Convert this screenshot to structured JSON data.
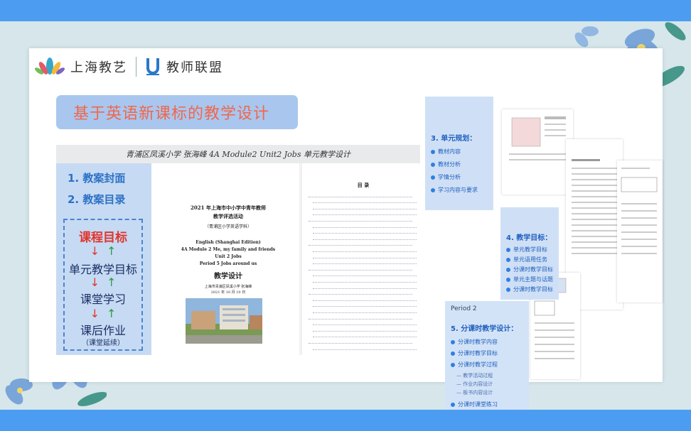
{
  "header": {
    "brand1": "上海教艺",
    "brand2": "教师联盟"
  },
  "slide": {
    "title": "基于英语新课标的教学设计",
    "strip": "青浦区凤溪小学  张海峰    4A Module2 Unit2  Jobs  单元教学设计"
  },
  "left_panel": {
    "item1": "1. 教案封面",
    "item2": "2. 教案目录",
    "flow": [
      "课程目标",
      "单元教学目标",
      "课堂学习",
      "课后作业"
    ],
    "flow_note": "（课堂延续）"
  },
  "cover": {
    "line1": "2021 年上海市中小学中青年教师",
    "line2": "教学评选活动",
    "line3": "（青浦区小学英语学科）",
    "line4": "English (Shanghai Edition)",
    "line5": "4A Module 2 Me, my family and friends",
    "line6": "Unit 2 Jobs",
    "line7": "Period 5 Jobs around us",
    "line8": "教学设计",
    "line9": "上海市青浦区凤溪小学    张海峰",
    "line10": "2021 年 10 月 10 日"
  },
  "toc": {
    "title": "目  录"
  },
  "cards": {
    "c3": {
      "heading": "3. 单元规划：",
      "items": [
        "教材内容",
        "教材分析",
        "学情分析",
        "学习内容与要求"
      ]
    },
    "c4": {
      "heading": "4. 教学目标：",
      "items": [
        "单元教学目标",
        "单元语用任务",
        "分课时教学目标",
        "单元主题与话题",
        "分课时教学目标"
      ]
    },
    "period": "Period 2",
    "c5": {
      "heading": "5. 分课时教学设计：",
      "items": [
        "分课时教学内容",
        "分课时教学目标",
        "分课时教学过程"
      ],
      "subs": [
        "— 教学活动过程",
        "— 作业内容设计",
        "— 板书内容设计"
      ],
      "last": "分课时课堂练习"
    }
  },
  "colors": {
    "top_bar": "#4c9df1",
    "title_bg": "#a9c6ef",
    "title_text": "#f0674a",
    "accent_blue": "#2d72c6"
  }
}
